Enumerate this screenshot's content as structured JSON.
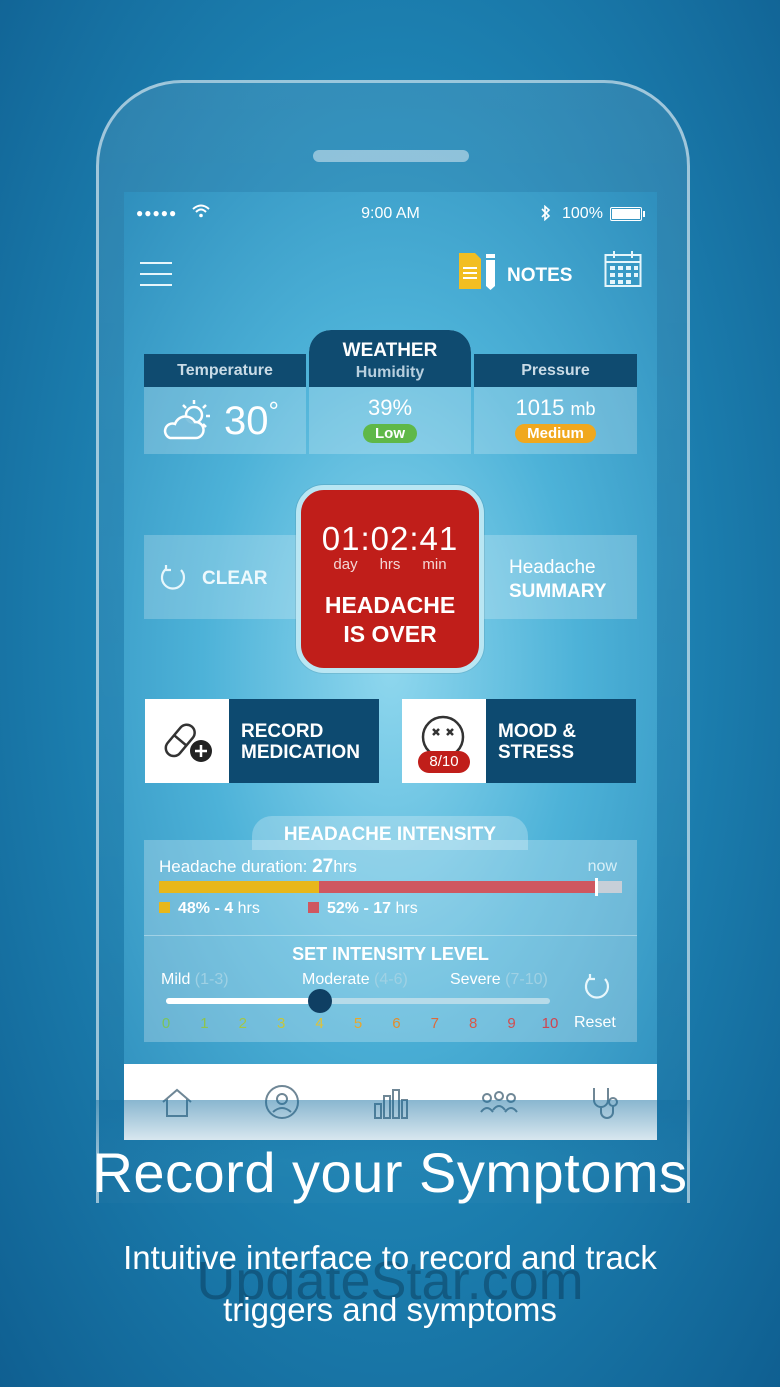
{
  "status_bar": {
    "signal": "●●●●●",
    "time": "9:00 AM",
    "battery": "100%"
  },
  "header": {
    "notes_label": "NOTES"
  },
  "weather": {
    "title": "WEATHER",
    "temperature": {
      "label": "Temperature",
      "value": "30",
      "unit": "°"
    },
    "humidity": {
      "label": "Humidity",
      "value": "39%",
      "badge": "Low",
      "badge_color": "#5fb848"
    },
    "pressure": {
      "label": "Pressure",
      "value": "1015",
      "unit": "mb",
      "badge": "Medium",
      "badge_color": "#f0a81e"
    }
  },
  "timer": {
    "clock": "01:02:41",
    "units": [
      "day",
      "hrs",
      "min"
    ],
    "message_line1": "HEADACHE",
    "message_line2": "IS OVER",
    "color": "#c01e1a"
  },
  "actions": {
    "clear_label": "CLEAR",
    "summary_line1": "Headache",
    "summary_line2": "SUMMARY"
  },
  "features": {
    "medication_line1": "RECORD",
    "medication_line2": "MEDICATION",
    "mood_line1": "MOOD &",
    "mood_line2": "STRESS",
    "mood_score": "8/10"
  },
  "intensity": {
    "title": "HEADACHE INTENSITY",
    "duration_label": "Headache duration: ",
    "duration_value": "27",
    "duration_unit": "hrs",
    "now_label": "now",
    "segment1": {
      "percent_text": "48%",
      "hours_text": "4",
      "unit": "hrs",
      "color": "#e8b71a",
      "fraction": 0.345
    },
    "segment2": {
      "percent_text": "52%",
      "hours_text": "17",
      "unit": "hrs",
      "color": "#cf5760",
      "fraction": 0.6
    },
    "set_title": "SET INTENSITY LEVEL",
    "levels": [
      {
        "name": "Mild",
        "range": "(1-3)"
      },
      {
        "name": "Moderate",
        "range": "(4-6)"
      },
      {
        "name": "Severe",
        "range": "(7-10)"
      }
    ],
    "current_level": 4,
    "scale": [
      "0",
      "1",
      "2",
      "3",
      "4",
      "5",
      "6",
      "7",
      "8",
      "9",
      "10"
    ],
    "scale_colors": [
      "#7bc45a",
      "#8ec44e",
      "#a3c747",
      "#c4c63d",
      "#e2c233",
      "#e8a82c",
      "#e38c2b",
      "#dd6a3a",
      "#d85a4a",
      "#d24d4f",
      "#cf4550"
    ],
    "reset_label": "Reset"
  },
  "tabs": [
    "home-icon",
    "profile-icon",
    "stats-icon",
    "community-icon",
    "doctor-icon"
  ],
  "promo": {
    "headline": "Record your Symptoms",
    "subline1": "Intuitive interface to record and track",
    "subline2": "triggers and symptoms",
    "watermark": "UpdateStar.com"
  }
}
